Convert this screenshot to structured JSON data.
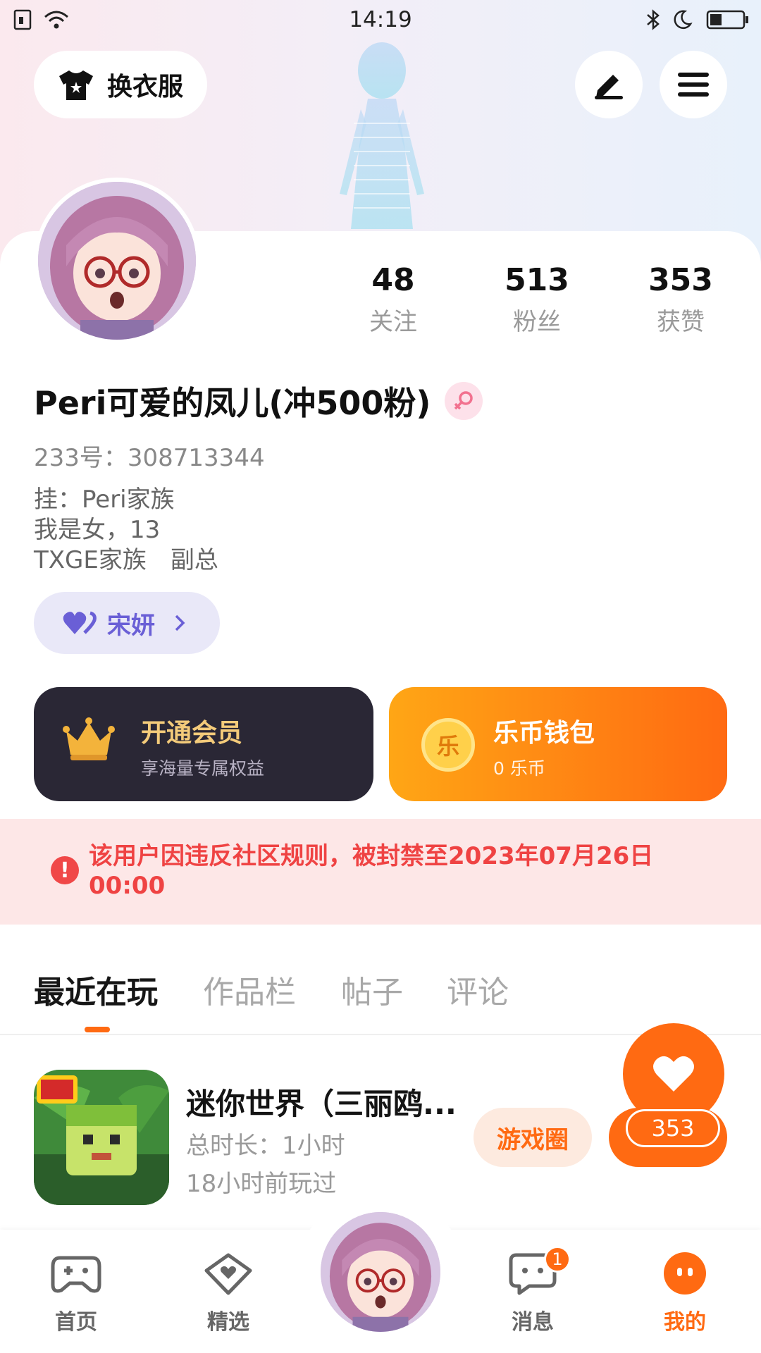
{
  "status_bar": {
    "time": "14:19"
  },
  "header": {
    "outfit_button_label": "换衣服",
    "edit_icon": "pen-icon",
    "menu_icon": "hamburger-menu-icon"
  },
  "profile": {
    "stats": [
      {
        "value": "48",
        "label": "关注"
      },
      {
        "value": "513",
        "label": "粉丝"
      },
      {
        "value": "353",
        "label": "获赞"
      }
    ],
    "username": "Peri可爱的凤儿(冲500粉)",
    "uid_line": "233号：308713344",
    "bio_lines": [
      "挂：Peri家族",
      "我是女，13",
      "TXGE家族　副总"
    ],
    "friend_chip_name": "宋妍"
  },
  "cards": {
    "vip": {
      "title": "开通会员",
      "subtitle": "享海量专属权益"
    },
    "wallet": {
      "title": "乐币钱包",
      "subtitle": "0 乐币",
      "coin_char": "乐"
    }
  },
  "ban_notice": {
    "icon_text": "!",
    "text": "该用户因违反社区规则，被封禁至2023年07月26日 00:00"
  },
  "tabs": [
    "最近在玩",
    "作品栏",
    "帖子",
    "评论"
  ],
  "recent_game": {
    "title": "迷你世界（三丽鸥...",
    "duration": "总时长：1小时",
    "last_played": "18小时前玩过",
    "circle_button": "游戏圈",
    "likes": "353"
  },
  "bottom_nav": {
    "items": [
      {
        "label": "首页",
        "icon": "gamepad-icon"
      },
      {
        "label": "精选",
        "icon": "heart-shield-icon"
      },
      {
        "label": "消息",
        "icon": "chat-bubble-icon",
        "badge": "1"
      },
      {
        "label": "我的",
        "icon": "profile-face-icon"
      }
    ]
  },
  "colors": {
    "accent": "#ff6a12",
    "vip_card": "#2a2735",
    "ban_text": "#ef4343",
    "friend_chip_text": "#6a5fd6"
  }
}
